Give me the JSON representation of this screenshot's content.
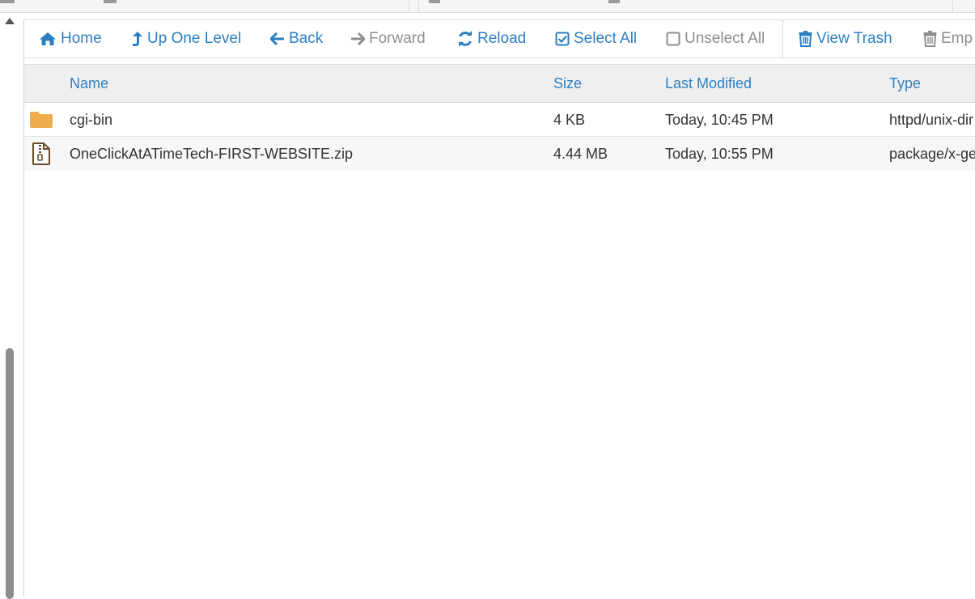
{
  "toolbar": {
    "home": "Home",
    "up_one_level": "Up One Level",
    "back": "Back",
    "forward": "Forward",
    "reload": "Reload",
    "select_all": "Select All",
    "unselect_all": "Unselect All",
    "view_trash": "View Trash",
    "empty_trash": "Emp"
  },
  "table": {
    "columns": {
      "name": "Name",
      "size": "Size",
      "last_modified": "Last Modified",
      "type": "Type"
    },
    "rows": [
      {
        "icon": "folder-icon",
        "name": "cgi-bin",
        "size": "4 KB",
        "last_modified": "Today, 10:45 PM",
        "type": "httpd/unix-dir"
      },
      {
        "icon": "zip-file-icon",
        "name": "OneClickAtATimeTech-FIRST-WEBSITE.zip",
        "size": "4.44 MB",
        "last_modified": "Today, 10:55 PM",
        "type": "package/x-generic"
      }
    ]
  },
  "colors": {
    "accent": "#2d7fc3",
    "disabled": "#8e8e8e",
    "folder": "#f0ad4e",
    "zip": "#6b4b2a",
    "header_bg": "#efefef"
  }
}
